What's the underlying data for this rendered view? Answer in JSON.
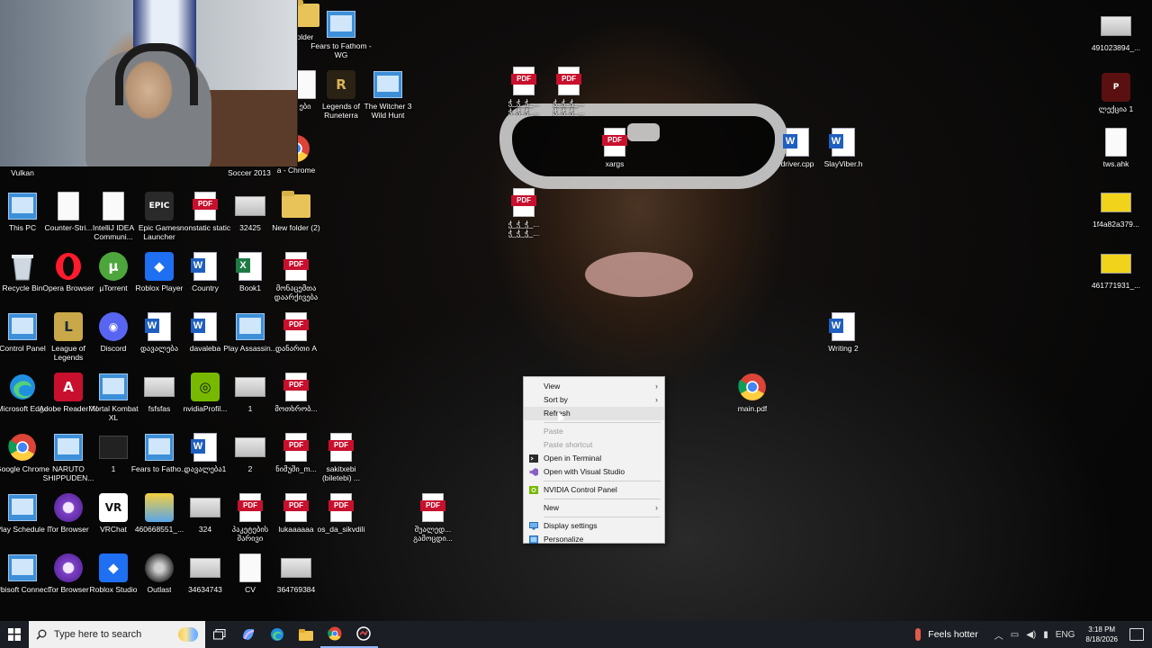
{
  "desktop": {
    "icons": [
      {
        "label": "Vulkan",
        "type": "webcam-hidden"
      },
      {
        "label": "older",
        "type": "folder"
      },
      {
        "label": "Fears to Fathom - WG",
        "type": "app"
      },
      {
        "label": "ები",
        "type": "file"
      },
      {
        "label": "Legends of Runeterra",
        "type": "runeterra"
      },
      {
        "label": "The Witcher 3 Wild Hunt",
        "type": "app"
      },
      {
        "label": "Soccer 2013",
        "type": "webcam-hidden"
      },
      {
        "label": "a - Chrome",
        "type": "chrome"
      },
      {
        "label": "This PC",
        "type": "pc"
      },
      {
        "label": "Counter-Stri...",
        "type": "file"
      },
      {
        "label": "IntelliJ IDEA Communi...",
        "type": "file"
      },
      {
        "label": "Epic Games Launcher",
        "type": "epic"
      },
      {
        "label": "nonstatic static",
        "type": "pdf"
      },
      {
        "label": "32425",
        "type": "img"
      },
      {
        "label": "New folder (2)",
        "type": "folder"
      },
      {
        "label": "Recycle Bin",
        "type": "recycle"
      },
      {
        "label": "Opera Browser",
        "type": "opera"
      },
      {
        "label": "µTorrent",
        "type": "utorrent"
      },
      {
        "label": "Roblox Player",
        "type": "roblox"
      },
      {
        "label": "Country",
        "type": "word"
      },
      {
        "label": "Book1",
        "type": "excel"
      },
      {
        "label": "მონაცემთა დაარქივება",
        "type": "pdf"
      },
      {
        "label": "Control Panel",
        "type": "app"
      },
      {
        "label": "League of Legends",
        "type": "league"
      },
      {
        "label": "Discord",
        "type": "discord"
      },
      {
        "label": "დავალება",
        "type": "word"
      },
      {
        "label": "davaleba",
        "type": "word"
      },
      {
        "label": "Play Assassin...",
        "type": "app"
      },
      {
        "label": "დანართი A",
        "type": "pdf"
      },
      {
        "label": "Microsoft Edge",
        "type": "edge"
      },
      {
        "label": "Adobe Reader XI",
        "type": "adobe"
      },
      {
        "label": "Mortal Kombat XL",
        "type": "app"
      },
      {
        "label": "fsfsfas",
        "type": "img"
      },
      {
        "label": "nvidiaProfil...",
        "type": "nvidia"
      },
      {
        "label": "1",
        "type": "img"
      },
      {
        "label": "მოთხრობ...",
        "type": "pdf"
      },
      {
        "label": "Google Chrome",
        "type": "chrome"
      },
      {
        "label": "NARUTO SHIPPUDEN...",
        "type": "app"
      },
      {
        "label": "1",
        "type": "dark"
      },
      {
        "label": "Fears to Fatho...",
        "type": "app"
      },
      {
        "label": "დავალება1",
        "type": "word"
      },
      {
        "label": "2",
        "type": "img"
      },
      {
        "label": "ნიმუში_m...",
        "type": "pdf"
      },
      {
        "label": "sakitxebi (biletebi) ...",
        "type": "pdf"
      },
      {
        "label": "Play Schedule I",
        "type": "app"
      },
      {
        "label": "Tor Browser",
        "type": "tor"
      },
      {
        "label": "VRChat",
        "type": "vrchat"
      },
      {
        "label": "460668551_...",
        "type": "meme"
      },
      {
        "label": "324",
        "type": "img"
      },
      {
        "label": "პაკეტების შარივი",
        "type": "pdf"
      },
      {
        "label": "lukaaaaaa",
        "type": "pdf"
      },
      {
        "label": "os_da_sikvdili",
        "type": "pdf"
      },
      {
        "label": "შუალედ... გამოცდი...",
        "type": "pdf"
      },
      {
        "label": "Ubisoft Connect",
        "type": "app"
      },
      {
        "label": "Tor Browser",
        "type": "tor"
      },
      {
        "label": "Roblox Studio",
        "type": "roblox"
      },
      {
        "label": "Outlast",
        "type": "outlast"
      },
      {
        "label": "34634743",
        "type": "img"
      },
      {
        "label": "CV",
        "type": "file"
      },
      {
        "label": "364769384",
        "type": "img"
      },
      {
        "label": "ჭ_ჭ_ჭ_... ჭ_ჭ_ჭ_...",
        "type": "pdf"
      },
      {
        "label": "ჭ_ჭ_ჭ_... ჭ_ჭ_ჭ_...",
        "type": "pdf"
      },
      {
        "label": "xargs",
        "type": "pdf"
      },
      {
        "label": "ჭ_ჭ_ჭ_... ჭ_ჭ_ჭ_...",
        "type": "pdf"
      },
      {
        "label": "driver.cpp",
        "type": "word"
      },
      {
        "label": "SlayViber.h",
        "type": "word"
      },
      {
        "label": "Writing 2",
        "type": "word"
      },
      {
        "label": "main.pdf",
        "type": "chrome"
      },
      {
        "label": "491023894_...",
        "type": "img"
      },
      {
        "label": "ლექცია 1",
        "type": "ppt"
      },
      {
        "label": "tws.ahk",
        "type": "file"
      },
      {
        "label": "1f4a82a379...",
        "type": "yellow"
      },
      {
        "label": "461771931_...",
        "type": "yellow"
      }
    ]
  },
  "context_menu": {
    "items": [
      {
        "label": "View",
        "submenu": true,
        "disabled": false
      },
      {
        "label": "Sort by",
        "submenu": true,
        "disabled": false
      },
      {
        "label": "Refresh",
        "submenu": false,
        "disabled": false,
        "hover": true
      },
      {
        "separator": true
      },
      {
        "label": "Paste",
        "submenu": false,
        "disabled": true
      },
      {
        "label": "Paste shortcut",
        "submenu": false,
        "disabled": true
      },
      {
        "label": "Open in Terminal",
        "submenu": false,
        "disabled": false,
        "icon": "terminal-icon"
      },
      {
        "label": "Open with Visual Studio",
        "submenu": false,
        "disabled": false,
        "icon": "visual-studio-icon"
      },
      {
        "separator": true
      },
      {
        "label": "NVIDIA Control Panel",
        "submenu": false,
        "disabled": false,
        "icon": "nvidia-icon"
      },
      {
        "separator": true
      },
      {
        "label": "New",
        "submenu": true,
        "disabled": false
      },
      {
        "separator": true
      },
      {
        "label": "Display settings",
        "submenu": false,
        "disabled": false,
        "icon": "display-icon"
      },
      {
        "label": "Personalize",
        "submenu": false,
        "disabled": false,
        "icon": "personalize-icon"
      }
    ]
  },
  "taskbar": {
    "search_placeholder": "Type here to search",
    "weather_text": "Feels hotter",
    "language": "ENG",
    "time": "3:18 PM",
    "date": "8/18/2026",
    "apps": [
      "task-view",
      "copilot",
      "edge",
      "file-explorer",
      "chrome",
      "other-app"
    ]
  },
  "colors": {
    "taskbar_bg": "#1b1e24",
    "menu_bg": "#f2f2f2",
    "pdf_red": "#c8102e",
    "word_blue": "#1f5fbf"
  }
}
